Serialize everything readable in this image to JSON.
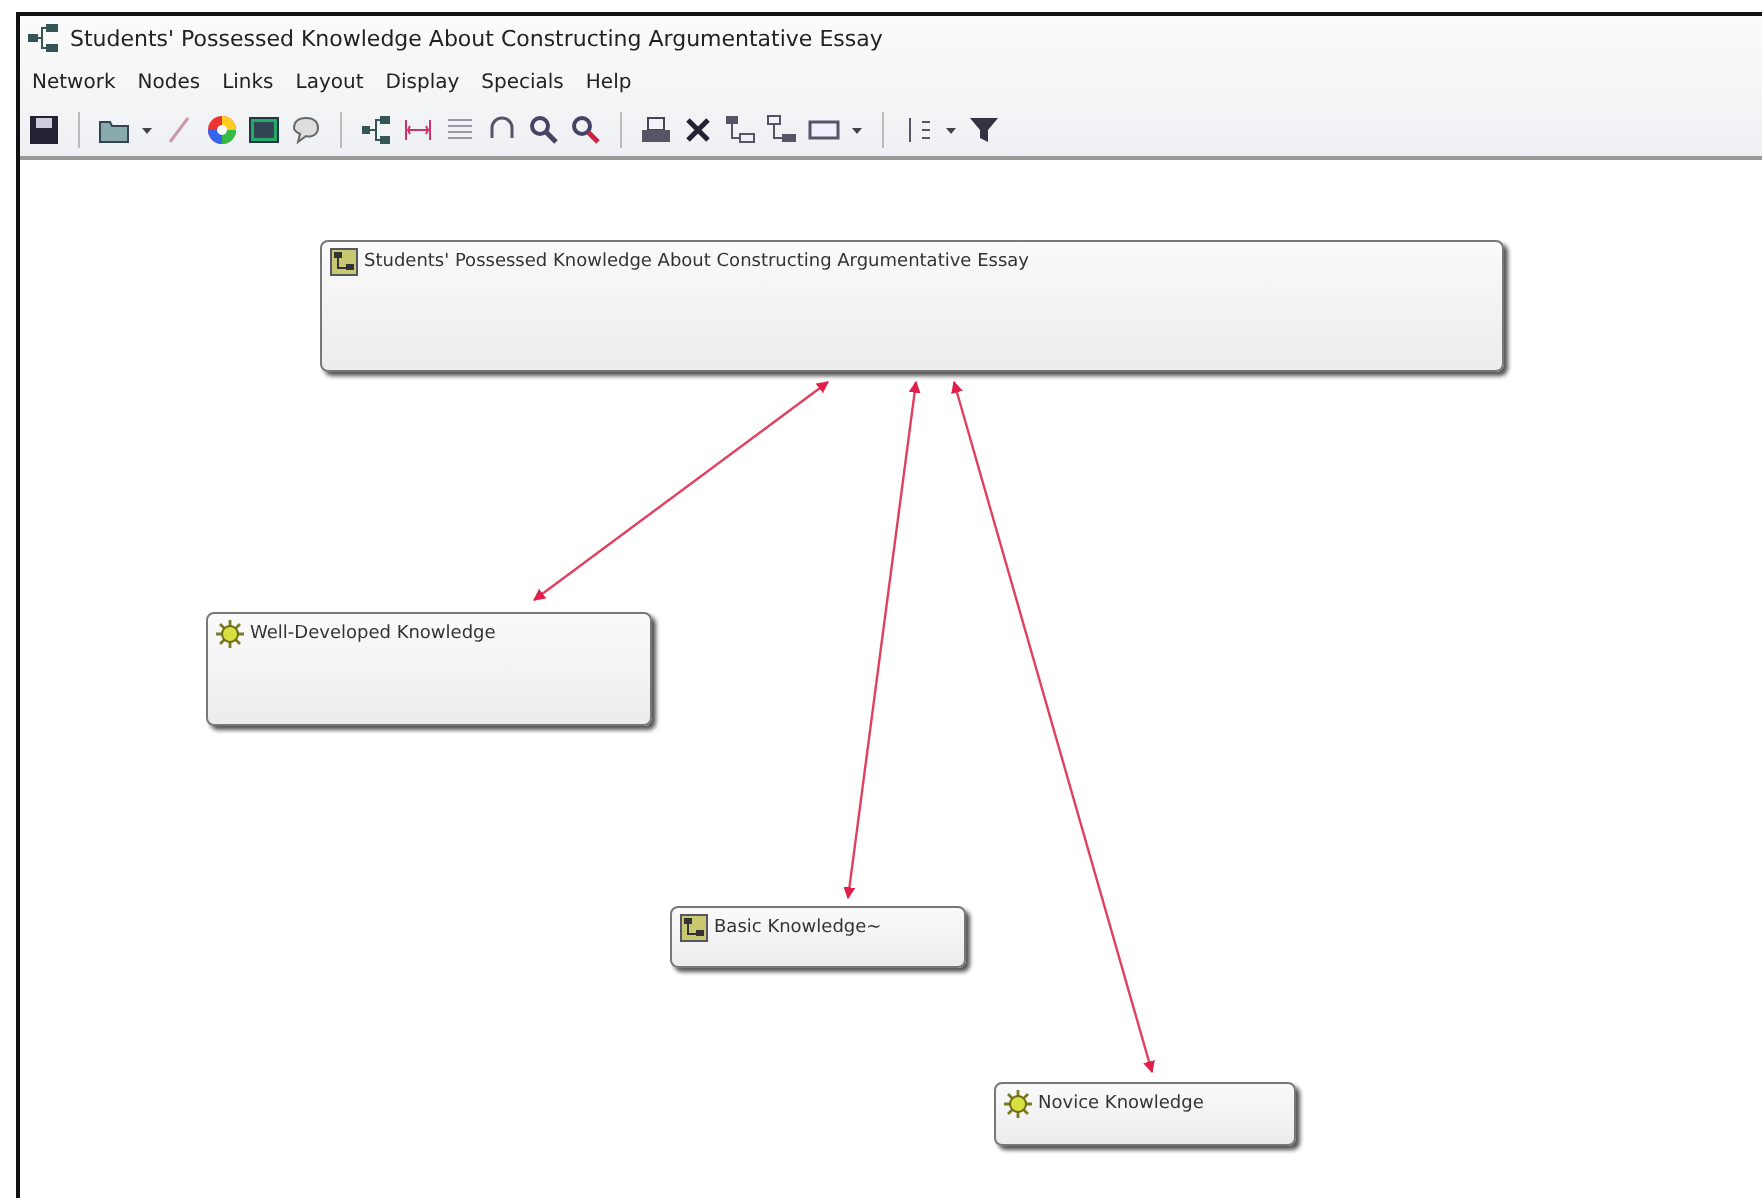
{
  "window": {
    "title": "Students' Possessed Knowledge About Constructing Argumentative Essay"
  },
  "menu": [
    "Network",
    "Nodes",
    "Links",
    "Layout",
    "Display",
    "Specials",
    "Help"
  ],
  "nodes": [
    {
      "label": "Students' Possessed Knowledge About Constructing Argumentative Essay",
      "kind": "network",
      "linked_to_root": false
    },
    {
      "label": "Well-Developed Knowledge",
      "kind": "sun",
      "linked_to_root": true
    },
    {
      "label": "Basic Knowledge~",
      "kind": "network",
      "linked_to_root": true
    },
    {
      "label": "Novice Knowledge",
      "kind": "sun",
      "linked_to_root": true
    }
  ]
}
